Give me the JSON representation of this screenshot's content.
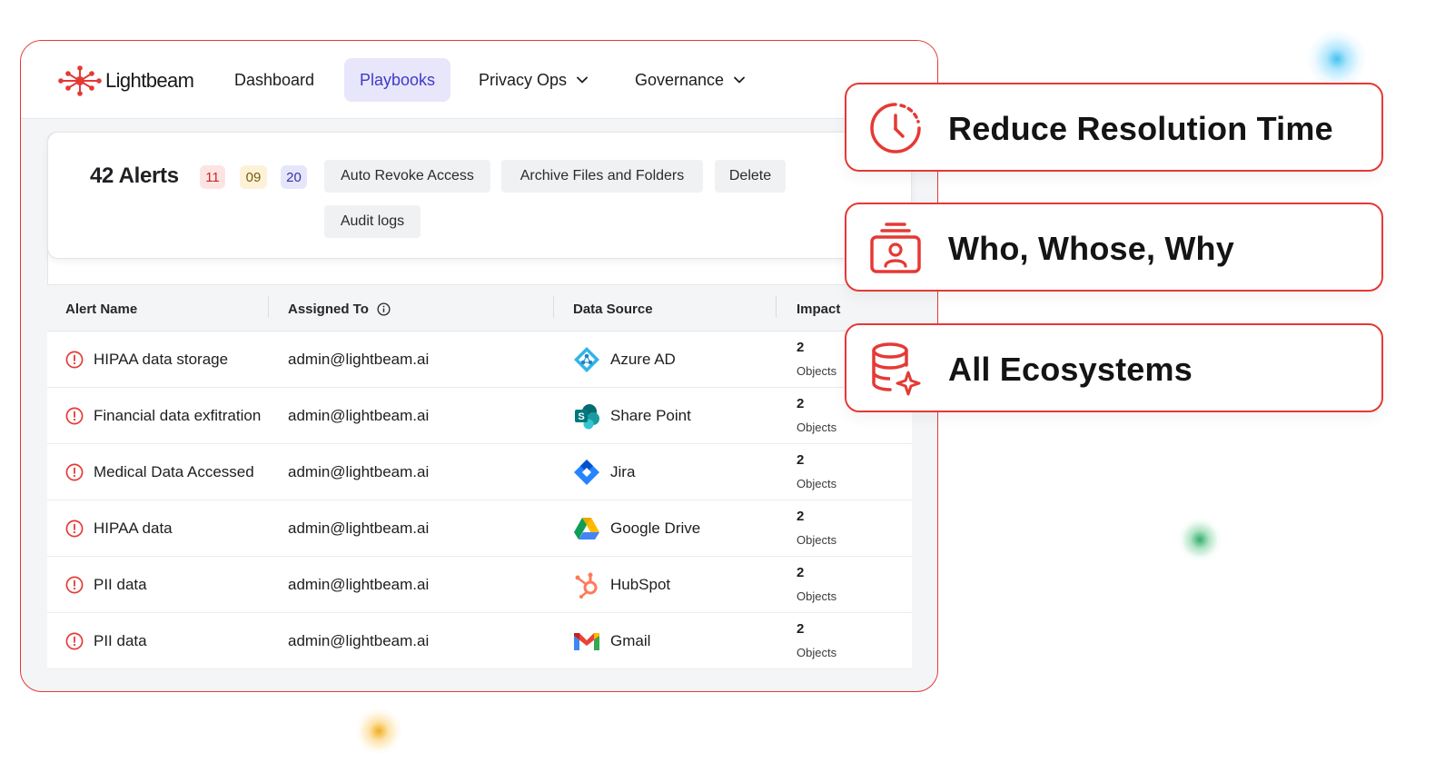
{
  "brand": {
    "name": "Lightbeam",
    "accent_color": "#e53935"
  },
  "nav": {
    "items": [
      {
        "label": "Dashboard"
      },
      {
        "label": "Playbooks",
        "active": true
      },
      {
        "label": "Privacy Ops",
        "icon": "chevron-down-icon"
      },
      {
        "label": "Governance",
        "icon": "chevron-down-icon"
      }
    ]
  },
  "alerts": {
    "title": "42 Alerts",
    "badges": [
      {
        "value": "11",
        "color": "#c62828"
      },
      {
        "value": "09",
        "color": "#7a5a10"
      },
      {
        "value": "20",
        "color": "#3531a8"
      }
    ],
    "actions": [
      {
        "label": "Auto Revoke Access"
      },
      {
        "label": "Archive Files and Folders"
      },
      {
        "label": "Delete"
      },
      {
        "label": "Audit logs"
      }
    ]
  },
  "table": {
    "columns": [
      "Alert Name",
      "Assigned To",
      "Data Source",
      "Impact"
    ],
    "rows": [
      {
        "name": "HIPAA data storage",
        "assigned": "admin@lightbeam.ai",
        "source": "Azure AD",
        "source_icon": "azure-ad-icon",
        "impact": "2",
        "unit": "Objects"
      },
      {
        "name": "Financial data exfitration",
        "assigned": "admin@lightbeam.ai",
        "source": "Share Point",
        "source_icon": "sharepoint-icon",
        "impact": "2",
        "unit": "Objects"
      },
      {
        "name": "Medical Data Accessed",
        "assigned": "admin@lightbeam.ai",
        "source": "Jira",
        "source_icon": "jira-icon",
        "impact": "2",
        "unit": "Objects"
      },
      {
        "name": "HIPAA data",
        "assigned": "admin@lightbeam.ai",
        "source": "Google Drive",
        "source_icon": "google-drive-icon",
        "impact": "2",
        "unit": "Objects"
      },
      {
        "name": "PII data",
        "assigned": "admin@lightbeam.ai",
        "source": "HubSpot",
        "source_icon": "hubspot-icon",
        "impact": "2",
        "unit": "Objects"
      },
      {
        "name": "PII data",
        "assigned": "admin@lightbeam.ai",
        "source": "Gmail",
        "source_icon": "gmail-icon",
        "impact": "2",
        "unit": "Objects"
      }
    ]
  },
  "features": [
    {
      "label": "Reduce Resolution Time",
      "icon": "clock-icon"
    },
    {
      "label": "Who, Whose, Why",
      "icon": "identity-badge-icon"
    },
    {
      "label": "All Ecosystems",
      "icon": "database-sparkle-icon"
    }
  ]
}
